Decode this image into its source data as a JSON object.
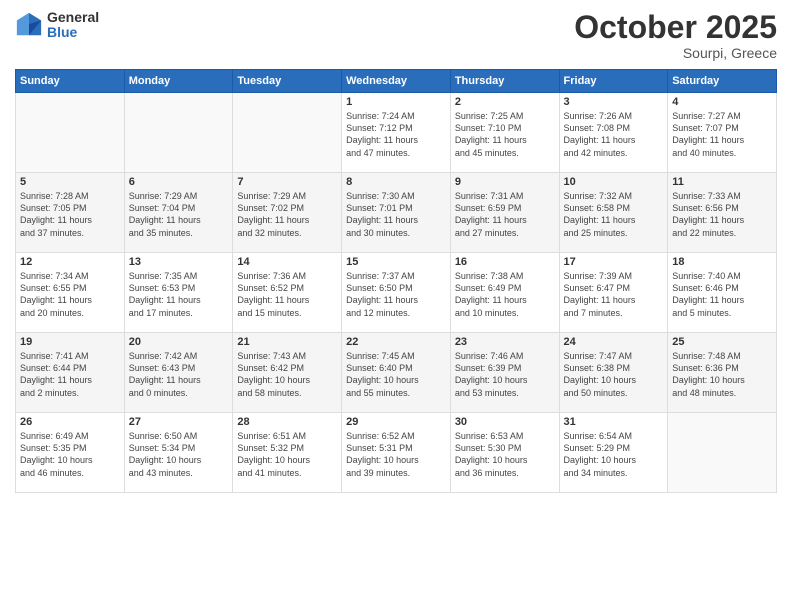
{
  "logo": {
    "general": "General",
    "blue": "Blue"
  },
  "header": {
    "month": "October 2025",
    "location": "Sourpi, Greece"
  },
  "weekdays": [
    "Sunday",
    "Monday",
    "Tuesday",
    "Wednesday",
    "Thursday",
    "Friday",
    "Saturday"
  ],
  "weeks": [
    [
      {
        "day": "",
        "info": ""
      },
      {
        "day": "",
        "info": ""
      },
      {
        "day": "",
        "info": ""
      },
      {
        "day": "1",
        "info": "Sunrise: 7:24 AM\nSunset: 7:12 PM\nDaylight: 11 hours\nand 47 minutes."
      },
      {
        "day": "2",
        "info": "Sunrise: 7:25 AM\nSunset: 7:10 PM\nDaylight: 11 hours\nand 45 minutes."
      },
      {
        "day": "3",
        "info": "Sunrise: 7:26 AM\nSunset: 7:08 PM\nDaylight: 11 hours\nand 42 minutes."
      },
      {
        "day": "4",
        "info": "Sunrise: 7:27 AM\nSunset: 7:07 PM\nDaylight: 11 hours\nand 40 minutes."
      }
    ],
    [
      {
        "day": "5",
        "info": "Sunrise: 7:28 AM\nSunset: 7:05 PM\nDaylight: 11 hours\nand 37 minutes."
      },
      {
        "day": "6",
        "info": "Sunrise: 7:29 AM\nSunset: 7:04 PM\nDaylight: 11 hours\nand 35 minutes."
      },
      {
        "day": "7",
        "info": "Sunrise: 7:29 AM\nSunset: 7:02 PM\nDaylight: 11 hours\nand 32 minutes."
      },
      {
        "day": "8",
        "info": "Sunrise: 7:30 AM\nSunset: 7:01 PM\nDaylight: 11 hours\nand 30 minutes."
      },
      {
        "day": "9",
        "info": "Sunrise: 7:31 AM\nSunset: 6:59 PM\nDaylight: 11 hours\nand 27 minutes."
      },
      {
        "day": "10",
        "info": "Sunrise: 7:32 AM\nSunset: 6:58 PM\nDaylight: 11 hours\nand 25 minutes."
      },
      {
        "day": "11",
        "info": "Sunrise: 7:33 AM\nSunset: 6:56 PM\nDaylight: 11 hours\nand 22 minutes."
      }
    ],
    [
      {
        "day": "12",
        "info": "Sunrise: 7:34 AM\nSunset: 6:55 PM\nDaylight: 11 hours\nand 20 minutes."
      },
      {
        "day": "13",
        "info": "Sunrise: 7:35 AM\nSunset: 6:53 PM\nDaylight: 11 hours\nand 17 minutes."
      },
      {
        "day": "14",
        "info": "Sunrise: 7:36 AM\nSunset: 6:52 PM\nDaylight: 11 hours\nand 15 minutes."
      },
      {
        "day": "15",
        "info": "Sunrise: 7:37 AM\nSunset: 6:50 PM\nDaylight: 11 hours\nand 12 minutes."
      },
      {
        "day": "16",
        "info": "Sunrise: 7:38 AM\nSunset: 6:49 PM\nDaylight: 11 hours\nand 10 minutes."
      },
      {
        "day": "17",
        "info": "Sunrise: 7:39 AM\nSunset: 6:47 PM\nDaylight: 11 hours\nand 7 minutes."
      },
      {
        "day": "18",
        "info": "Sunrise: 7:40 AM\nSunset: 6:46 PM\nDaylight: 11 hours\nand 5 minutes."
      }
    ],
    [
      {
        "day": "19",
        "info": "Sunrise: 7:41 AM\nSunset: 6:44 PM\nDaylight: 11 hours\nand 2 minutes."
      },
      {
        "day": "20",
        "info": "Sunrise: 7:42 AM\nSunset: 6:43 PM\nDaylight: 11 hours\nand 0 minutes."
      },
      {
        "day": "21",
        "info": "Sunrise: 7:43 AM\nSunset: 6:42 PM\nDaylight: 10 hours\nand 58 minutes."
      },
      {
        "day": "22",
        "info": "Sunrise: 7:45 AM\nSunset: 6:40 PM\nDaylight: 10 hours\nand 55 minutes."
      },
      {
        "day": "23",
        "info": "Sunrise: 7:46 AM\nSunset: 6:39 PM\nDaylight: 10 hours\nand 53 minutes."
      },
      {
        "day": "24",
        "info": "Sunrise: 7:47 AM\nSunset: 6:38 PM\nDaylight: 10 hours\nand 50 minutes."
      },
      {
        "day": "25",
        "info": "Sunrise: 7:48 AM\nSunset: 6:36 PM\nDaylight: 10 hours\nand 48 minutes."
      }
    ],
    [
      {
        "day": "26",
        "info": "Sunrise: 6:49 AM\nSunset: 5:35 PM\nDaylight: 10 hours\nand 46 minutes."
      },
      {
        "day": "27",
        "info": "Sunrise: 6:50 AM\nSunset: 5:34 PM\nDaylight: 10 hours\nand 43 minutes."
      },
      {
        "day": "28",
        "info": "Sunrise: 6:51 AM\nSunset: 5:32 PM\nDaylight: 10 hours\nand 41 minutes."
      },
      {
        "day": "29",
        "info": "Sunrise: 6:52 AM\nSunset: 5:31 PM\nDaylight: 10 hours\nand 39 minutes."
      },
      {
        "day": "30",
        "info": "Sunrise: 6:53 AM\nSunset: 5:30 PM\nDaylight: 10 hours\nand 36 minutes."
      },
      {
        "day": "31",
        "info": "Sunrise: 6:54 AM\nSunset: 5:29 PM\nDaylight: 10 hours\nand 34 minutes."
      },
      {
        "day": "",
        "info": ""
      }
    ]
  ]
}
